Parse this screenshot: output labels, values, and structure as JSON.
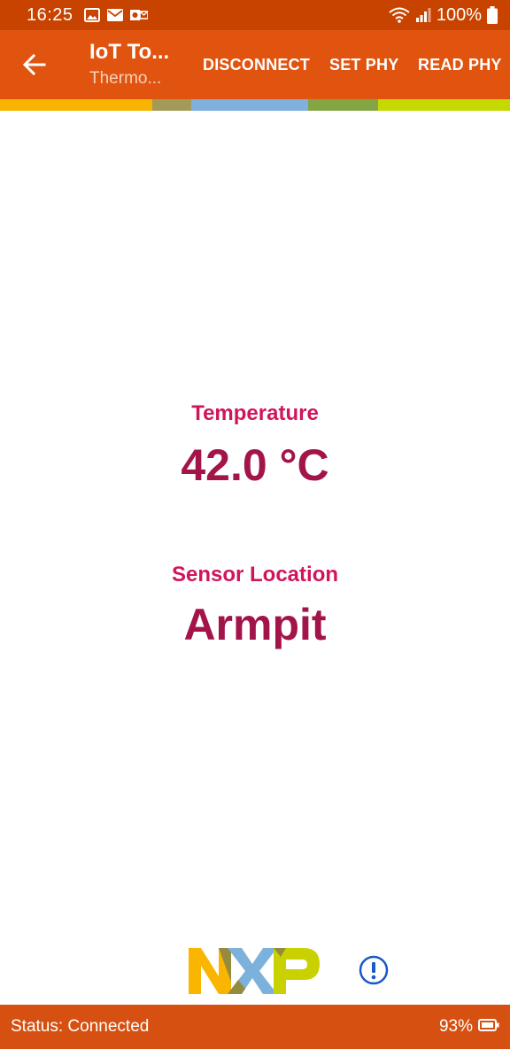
{
  "status_bar": {
    "time": "16:25",
    "battery_percent": "100%",
    "notification_icons": [
      "image-icon",
      "mail-icon",
      "outlook-icon"
    ]
  },
  "app_bar": {
    "title": "IoT To...",
    "subtitle": "Thermo...",
    "actions": {
      "disconnect": "DISCONNECT",
      "set_phy": "SET PHY",
      "read_phy": "READ PHY"
    }
  },
  "stripe_colors": [
    "#f7b500",
    "#a29a59",
    "#7fb0de",
    "#84a544",
    "#c5d800"
  ],
  "stripe_fractions": [
    0.299,
    0.076,
    0.23,
    0.137,
    0.258
  ],
  "content": {
    "temperature_label": "Temperature",
    "temperature_value": "42.0 °C",
    "location_label": "Sensor Location",
    "location_value": "Armpit"
  },
  "footer": {
    "logo_colors": {
      "n": "#f9b500",
      "x": "#7bb1db",
      "p": "#c9d200",
      "dark": "#958b3d"
    },
    "info_color": "#1a57c7"
  },
  "bottom_bar": {
    "status": "Status: Connected",
    "battery": "93%"
  },
  "colors": {
    "status_bar": "#c84300",
    "app_bar": "#e05410",
    "label": "#d0155a",
    "value": "#a3154a",
    "bottom_bar": "#d65111"
  }
}
